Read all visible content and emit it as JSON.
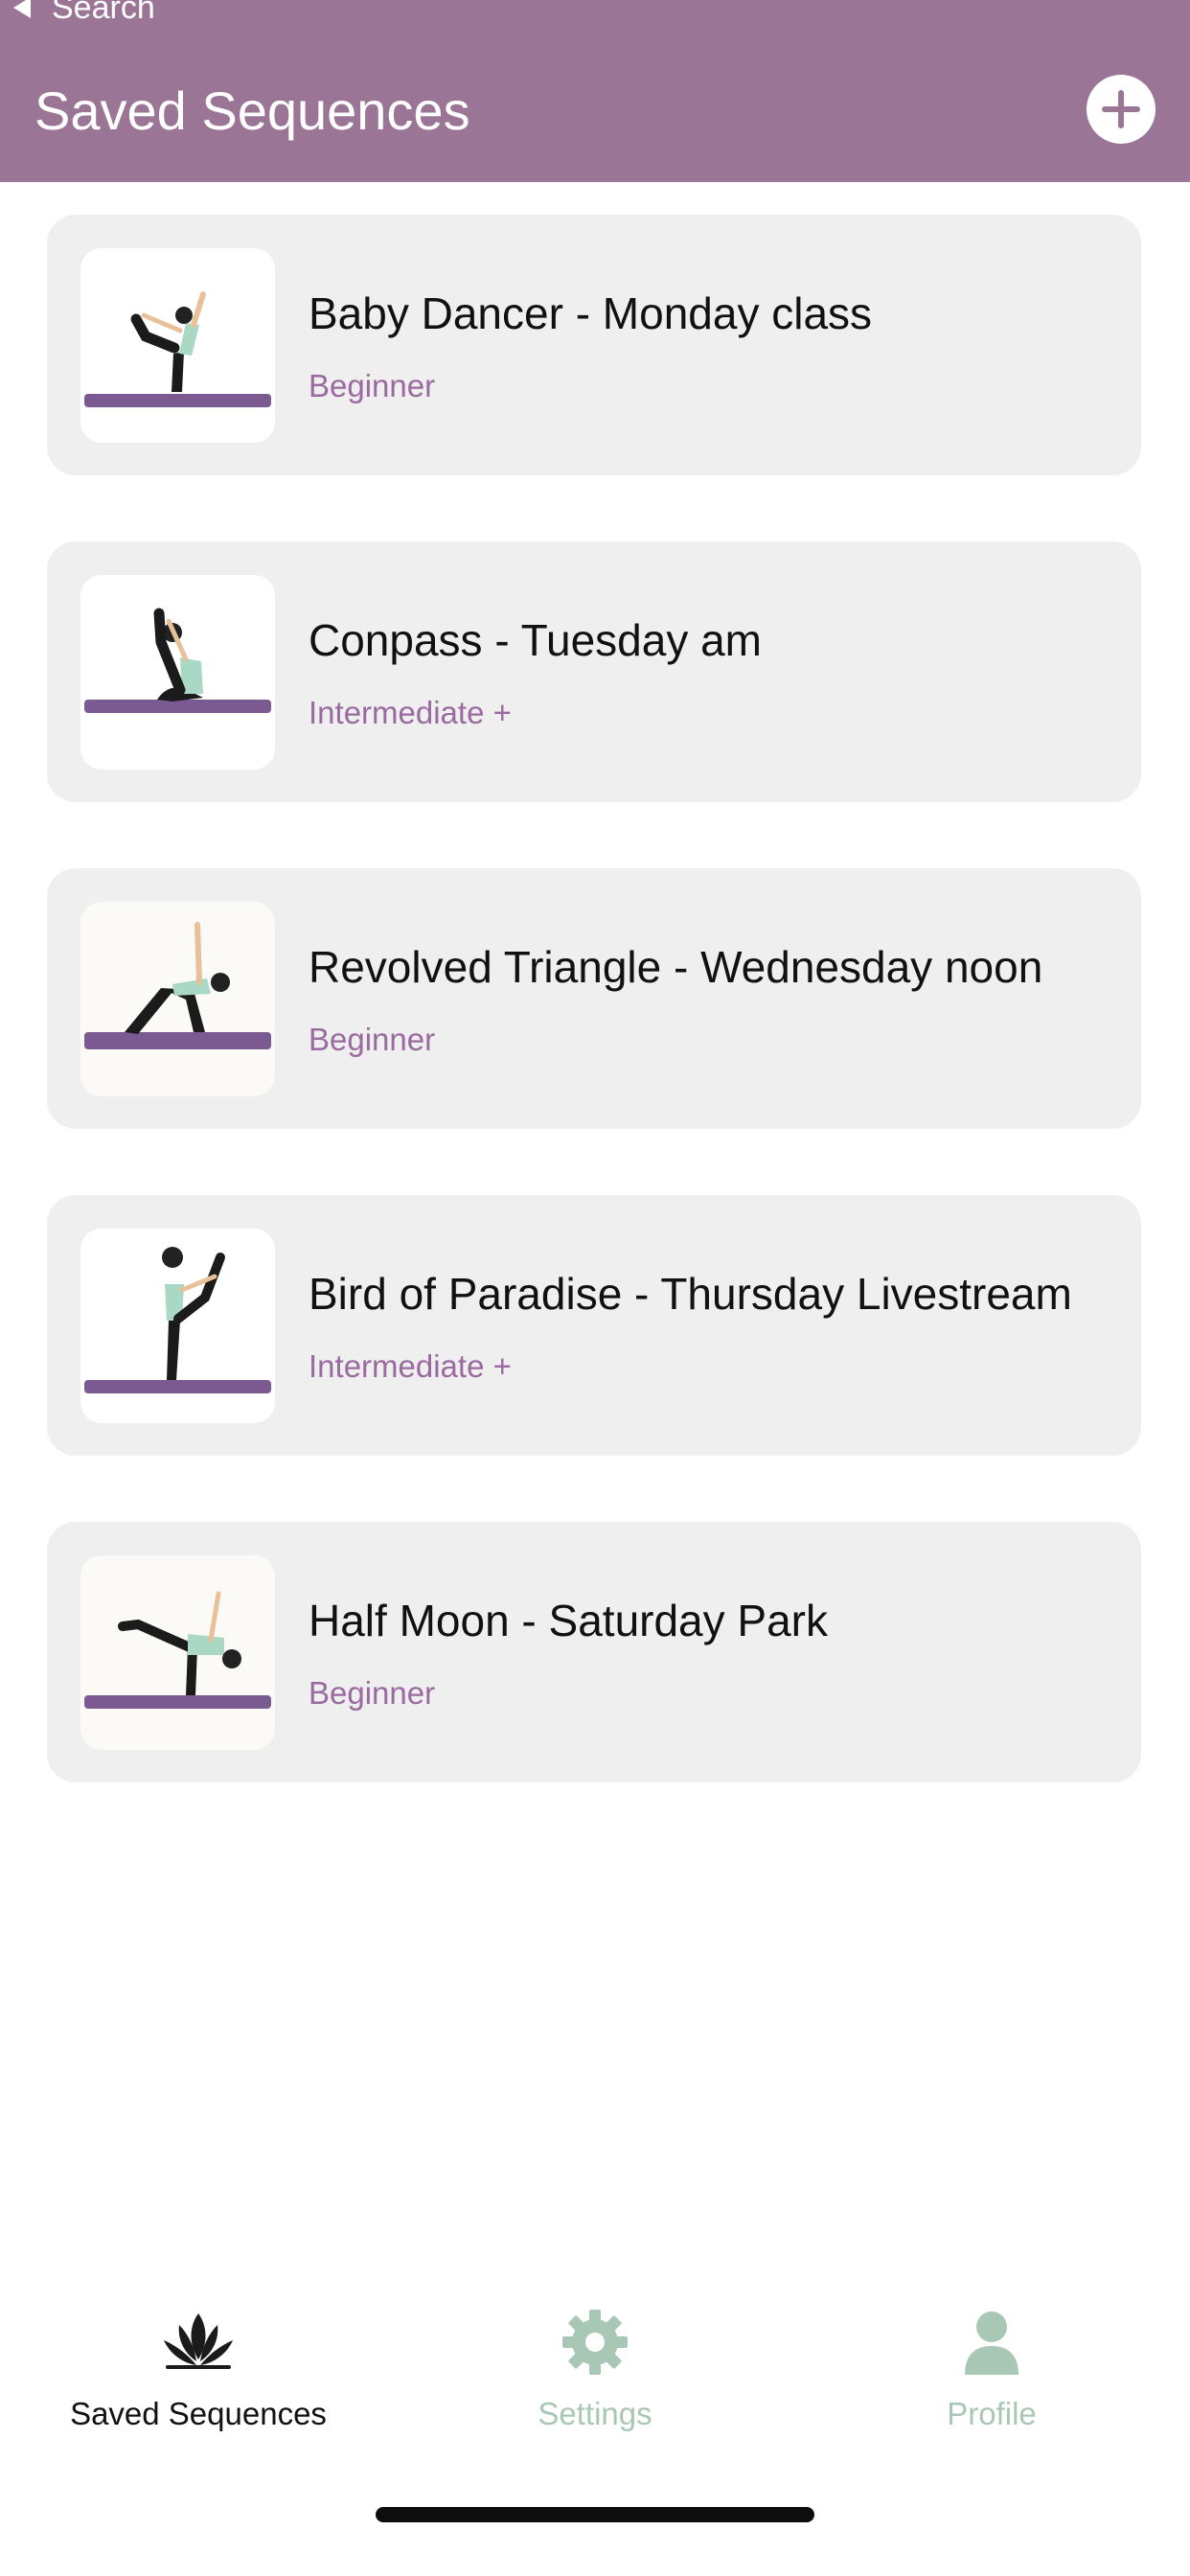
{
  "header": {
    "back_label": "Search",
    "title": "Saved Sequences",
    "add_icon": "plus-circle-icon"
  },
  "sequences": [
    {
      "title": "Baby Dancer - Monday class",
      "level": "Beginner",
      "image": "yoga-dancer-pose-illustration"
    },
    {
      "title": "Conpass - Tuesday am",
      "level": "Intermediate +",
      "image": "yoga-compass-pose-illustration"
    },
    {
      "title": "Revolved Triangle - Wednesday noon",
      "level": "Beginner",
      "image": "yoga-revolved-triangle-illustration"
    },
    {
      "title": "Bird of Paradise - Thursday Livestream",
      "level": "Intermediate +",
      "image": "yoga-bird-of-paradise-illustration"
    },
    {
      "title": "Half Moon - Saturday Park",
      "level": "Beginner",
      "image": "yoga-half-moon-illustration"
    }
  ],
  "tabbar": {
    "tabs": [
      {
        "label": "Saved Sequences",
        "icon": "lotus-icon",
        "active": true
      },
      {
        "label": "Settings",
        "icon": "gear-icon",
        "active": false
      },
      {
        "label": "Profile",
        "icon": "person-icon",
        "active": false
      }
    ]
  },
  "colors": {
    "header_bg": "#9a7595",
    "accent_text": "#9a6aa0",
    "inactive_tab": "#a9c7b5",
    "card_bg": "#efefef",
    "mat": "#7b5a92"
  }
}
